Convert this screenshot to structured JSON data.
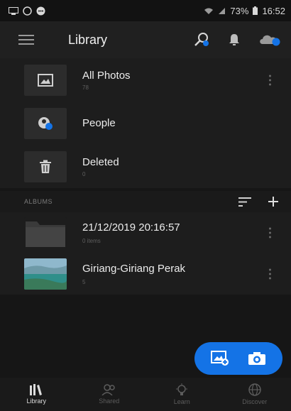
{
  "status_bar": {
    "battery_percent": "73%",
    "time": "16:52"
  },
  "app_bar": {
    "title": "Library"
  },
  "library_items": [
    {
      "label": "All Photos",
      "sub": "78"
    },
    {
      "label": "People",
      "sub": ""
    },
    {
      "label": "Deleted",
      "sub": "0"
    }
  ],
  "albums_header": {
    "label": "ALBUMS"
  },
  "albums": [
    {
      "label": "21/12/2019 20:16:57",
      "sub": "0 items"
    },
    {
      "label": "Giriang-Giriang Perak",
      "sub": "5"
    }
  ],
  "bottom_nav": [
    {
      "label": "Library"
    },
    {
      "label": "Shared"
    },
    {
      "label": "Learn"
    },
    {
      "label": "Discover"
    }
  ],
  "colors": {
    "accent": "#1473e6",
    "background": "#161616"
  }
}
